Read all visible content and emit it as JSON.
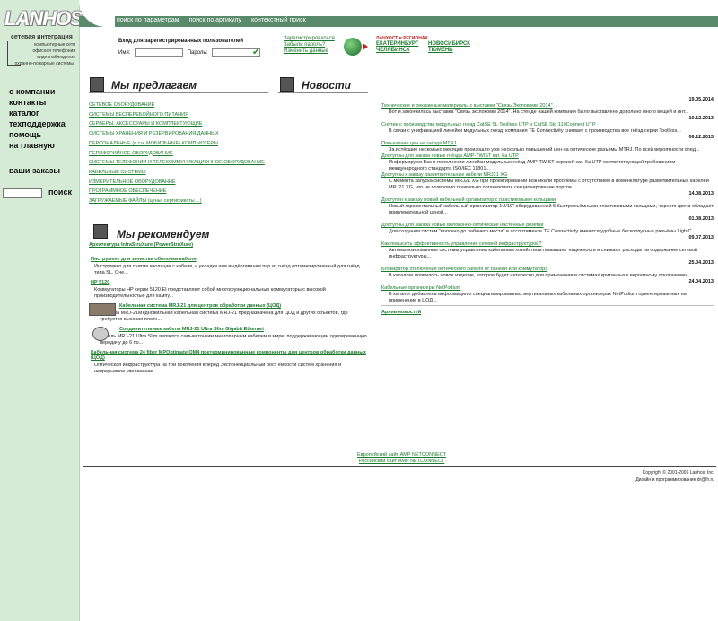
{
  "logo": {
    "text": "LANHOST",
    "tagline": "сетевая интеграция",
    "services": [
      "компьютерные сети",
      "офисная телефония",
      "видеонаблюдение",
      "охранно-пожарные системы"
    ]
  },
  "top_tabs": [
    "поиск по параметрам",
    "поиск по артикулу",
    "контекстный поиск"
  ],
  "login": {
    "title": "Вход для зарегистрированных пользователей",
    "name_label": "Имя:",
    "password_label": "Пароль:",
    "name_value": "",
    "password_value": "",
    "links": [
      "Зарегистрироваться",
      "Забыли пароль?",
      "Изменить данные"
    ]
  },
  "regions": {
    "title": "ЛАНХОСТ в РЕГИОНАХ",
    "cities": [
      "ЕКАТЕРИНБУРГ",
      "НОВОСИБИРСК",
      "ЧЕЛЯБИНСК",
      "ТЮМЕНЬ"
    ]
  },
  "left_nav": {
    "items": [
      "о компании",
      "контакты",
      "каталог",
      "техподдержка",
      "помощь",
      "на главную"
    ],
    "orders": "ваши заказы",
    "search_button": "поиск",
    "search_value": ""
  },
  "offer": {
    "title": "Мы предлагаем",
    "items": [
      "СЕТЕВОЕ ОБОРУДОВАНИЕ",
      "СИСТЕМЫ БЕСПЕРЕБОЙНОГО ПИТАНИЯ",
      "СЕРВЕРЫ, АКСЕССУАРЫ И КОМПЛЕКТУЮЩИЕ",
      "СИСТЕМЫ ХРАНЕНИЯ И РЕЗЕРВИРОВАНИЯ ДАННЫХ",
      "ПЕРСОНАЛЬНЫЕ (в т.ч. МОБИЛЬНЫЕ) КОМПЬЮТЕРЫ",
      "ПЕРИФЕРИЙНОЕ ОБОРУДОВАНИЕ",
      "СИСТЕМЫ ТЕЛЕФОНИИ И ТЕЛЕКОММУНИКАЦИОННОЕ ОБОРУДОВАНИЕ",
      "КАБЕЛЬНЫЕ СИСТЕМЫ",
      "ИЗМЕРИТЕЛЬНОЕ ОБОРУДОВАНИЕ",
      "ПРОГРАММНОЕ ОБЕСПЕЧЕНИЕ",
      "ЗАГРУЖАЕМЫЕ ФАЙЛЫ (цены, сертификаты ...)"
    ]
  },
  "recommend": {
    "title": "Мы рекомендуем",
    "items": [
      {
        "title": "Архитектура InfraStruXure (PowerStruXure)",
        "text": ""
      },
      {
        "title": "Инструмент для зачистки оболочки кабеля",
        "text": "Инструмент для снятия изоляции с кабеля, и укладки или выдёргивания пар из гнёзд оптимизированный для гнёзд типа SL. Оче..."
      },
      {
        "title": "HP 5120",
        "text": "Коммутаторы HP серии 5120 EI представляют собой многофункциональные коммутаторы с высокой производительностью для кампу..."
      },
      {
        "title": "Кабельная система MRJ-21 для центров обработки данных (ЦОД)",
        "text": "Система MRJ-21Медножильная кабельная система MRJ-21 предназначена для ЦОД и других объектов, где требуется высокая плотн..."
      },
      {
        "title": "Соединительные кабели MRJ-21 Ultra Slim Gigabit Ethernet",
        "text": "Кабель MRJ-21 Ultra Slim является самым тонким многопарным кабелем в мире, поддерживающим одновременную передачу до 6 по..."
      },
      {
        "title": "Кабельная система 24 fiber MPOptimate OM4 претерминированные компоненты для центров обработки данных (ЦОД)",
        "text": "Оптическая инфраструктура на три поколения вперед Экспоненциальный рост емкости систем хранения и непрерывное увеличение..."
      }
    ]
  },
  "news": {
    "title": "Новости",
    "archive": "Архив новостей",
    "items": [
      {
        "date": "19.05.2014",
        "title": "Технические и рекламные материалы с выставки \"Связь Экспокомм 2014\"",
        "text": "Вот и закончилась выставка \"Связь экспокомм 2014\". На стенде нашей компании было выставлено довольно много вещей и инт..."
      },
      {
        "date": "10.12.2013",
        "title": "Снятие с производства модульных гнезд CatSE SL Toolless UTP и CatSE Std 110Connect UTP",
        "text": "В связи с унификацией линейки модульных гнезд, компания TE Connectivity снимает с производства все гнёзд серии Toolless..."
      },
      {
        "date": "06.12.2013",
        "title": "Повышение цен на гнёзда MTRJ",
        "text": "За истёкшие несколько месяцев произошло уже несколько повышений цен на оптические разъёмы MTRJ. По всей вероятности след..."
      },
      {
        "date": "",
        "title": "Доступны для заказа новые гнёзда AMP-TWIST кат. 6a UTP",
        "text": "Информируем Вас о пополнении линейки модульных гнёзд AMP-TWIST версией кат. 6a UTP соответствующей требованиям международного стандарта ISO/IEC 11801..."
      },
      {
        "date": "",
        "title": "Доступны к заказу разветвительные кабели MRJ21 XG",
        "text": "С момента запуска системы MRJ21 XG при проектировании возникали проблемы с отсутствием в номенклатуре разветвительных кабелей MRJ21 XG, что не позволяло правильно организовать секционирование портов..."
      },
      {
        "date": "14.08.2013",
        "title": "Доступен к заказу новый кабельный организатор с пластиковыми кольцами",
        "text": "Новый горизонтальный кабельный организатор 1U/19\" оборудованный 5 быстросъёмными пластиковыми кольцами, черного цвета обладает привлекательной ценой..."
      },
      {
        "date": "01.08.2013",
        "title": "Доступны для заказа новые волоконно-оптические настенные розетки",
        "text": "Для создания систем \"волокно до рабочего места\" в ассортименте TE Connectivity имеются удобные бескорпусные разъёмы LightC..."
      },
      {
        "date": "09.07.2013",
        "title": "Как повысить эффективность управления сетевой инфраструктурой?",
        "text": "Автоматизированные системы управления кабельным хозяйством повышают надежность и снижают расходы на содержание сетевой инфраструктуры..."
      },
      {
        "date": "25.04.2013",
        "title": "Блокиратор отключения оптического кабеля от панели или коммутатора",
        "text": "В каталоге появилось новое изделие, которое будет интересно для применения в системах критичных к вероятному отключению..."
      },
      {
        "date": "24.04.2013",
        "title": "Кабельные организеры NetPodium",
        "text": "В каталог добавлена информация о специализированных вертикальных кабельных организерах NetPodium ориентированных на применение в ЦОД..."
      }
    ]
  },
  "footer": {
    "links": [
      "Европейский сайт AMP NETCONNECT",
      "Российский сайт AMP NETCONNECT"
    ],
    "copyright": "Copyright © 2001-2005 Lanhost Inc.",
    "design": "Дизайн и программирование dr@lh.ru"
  }
}
